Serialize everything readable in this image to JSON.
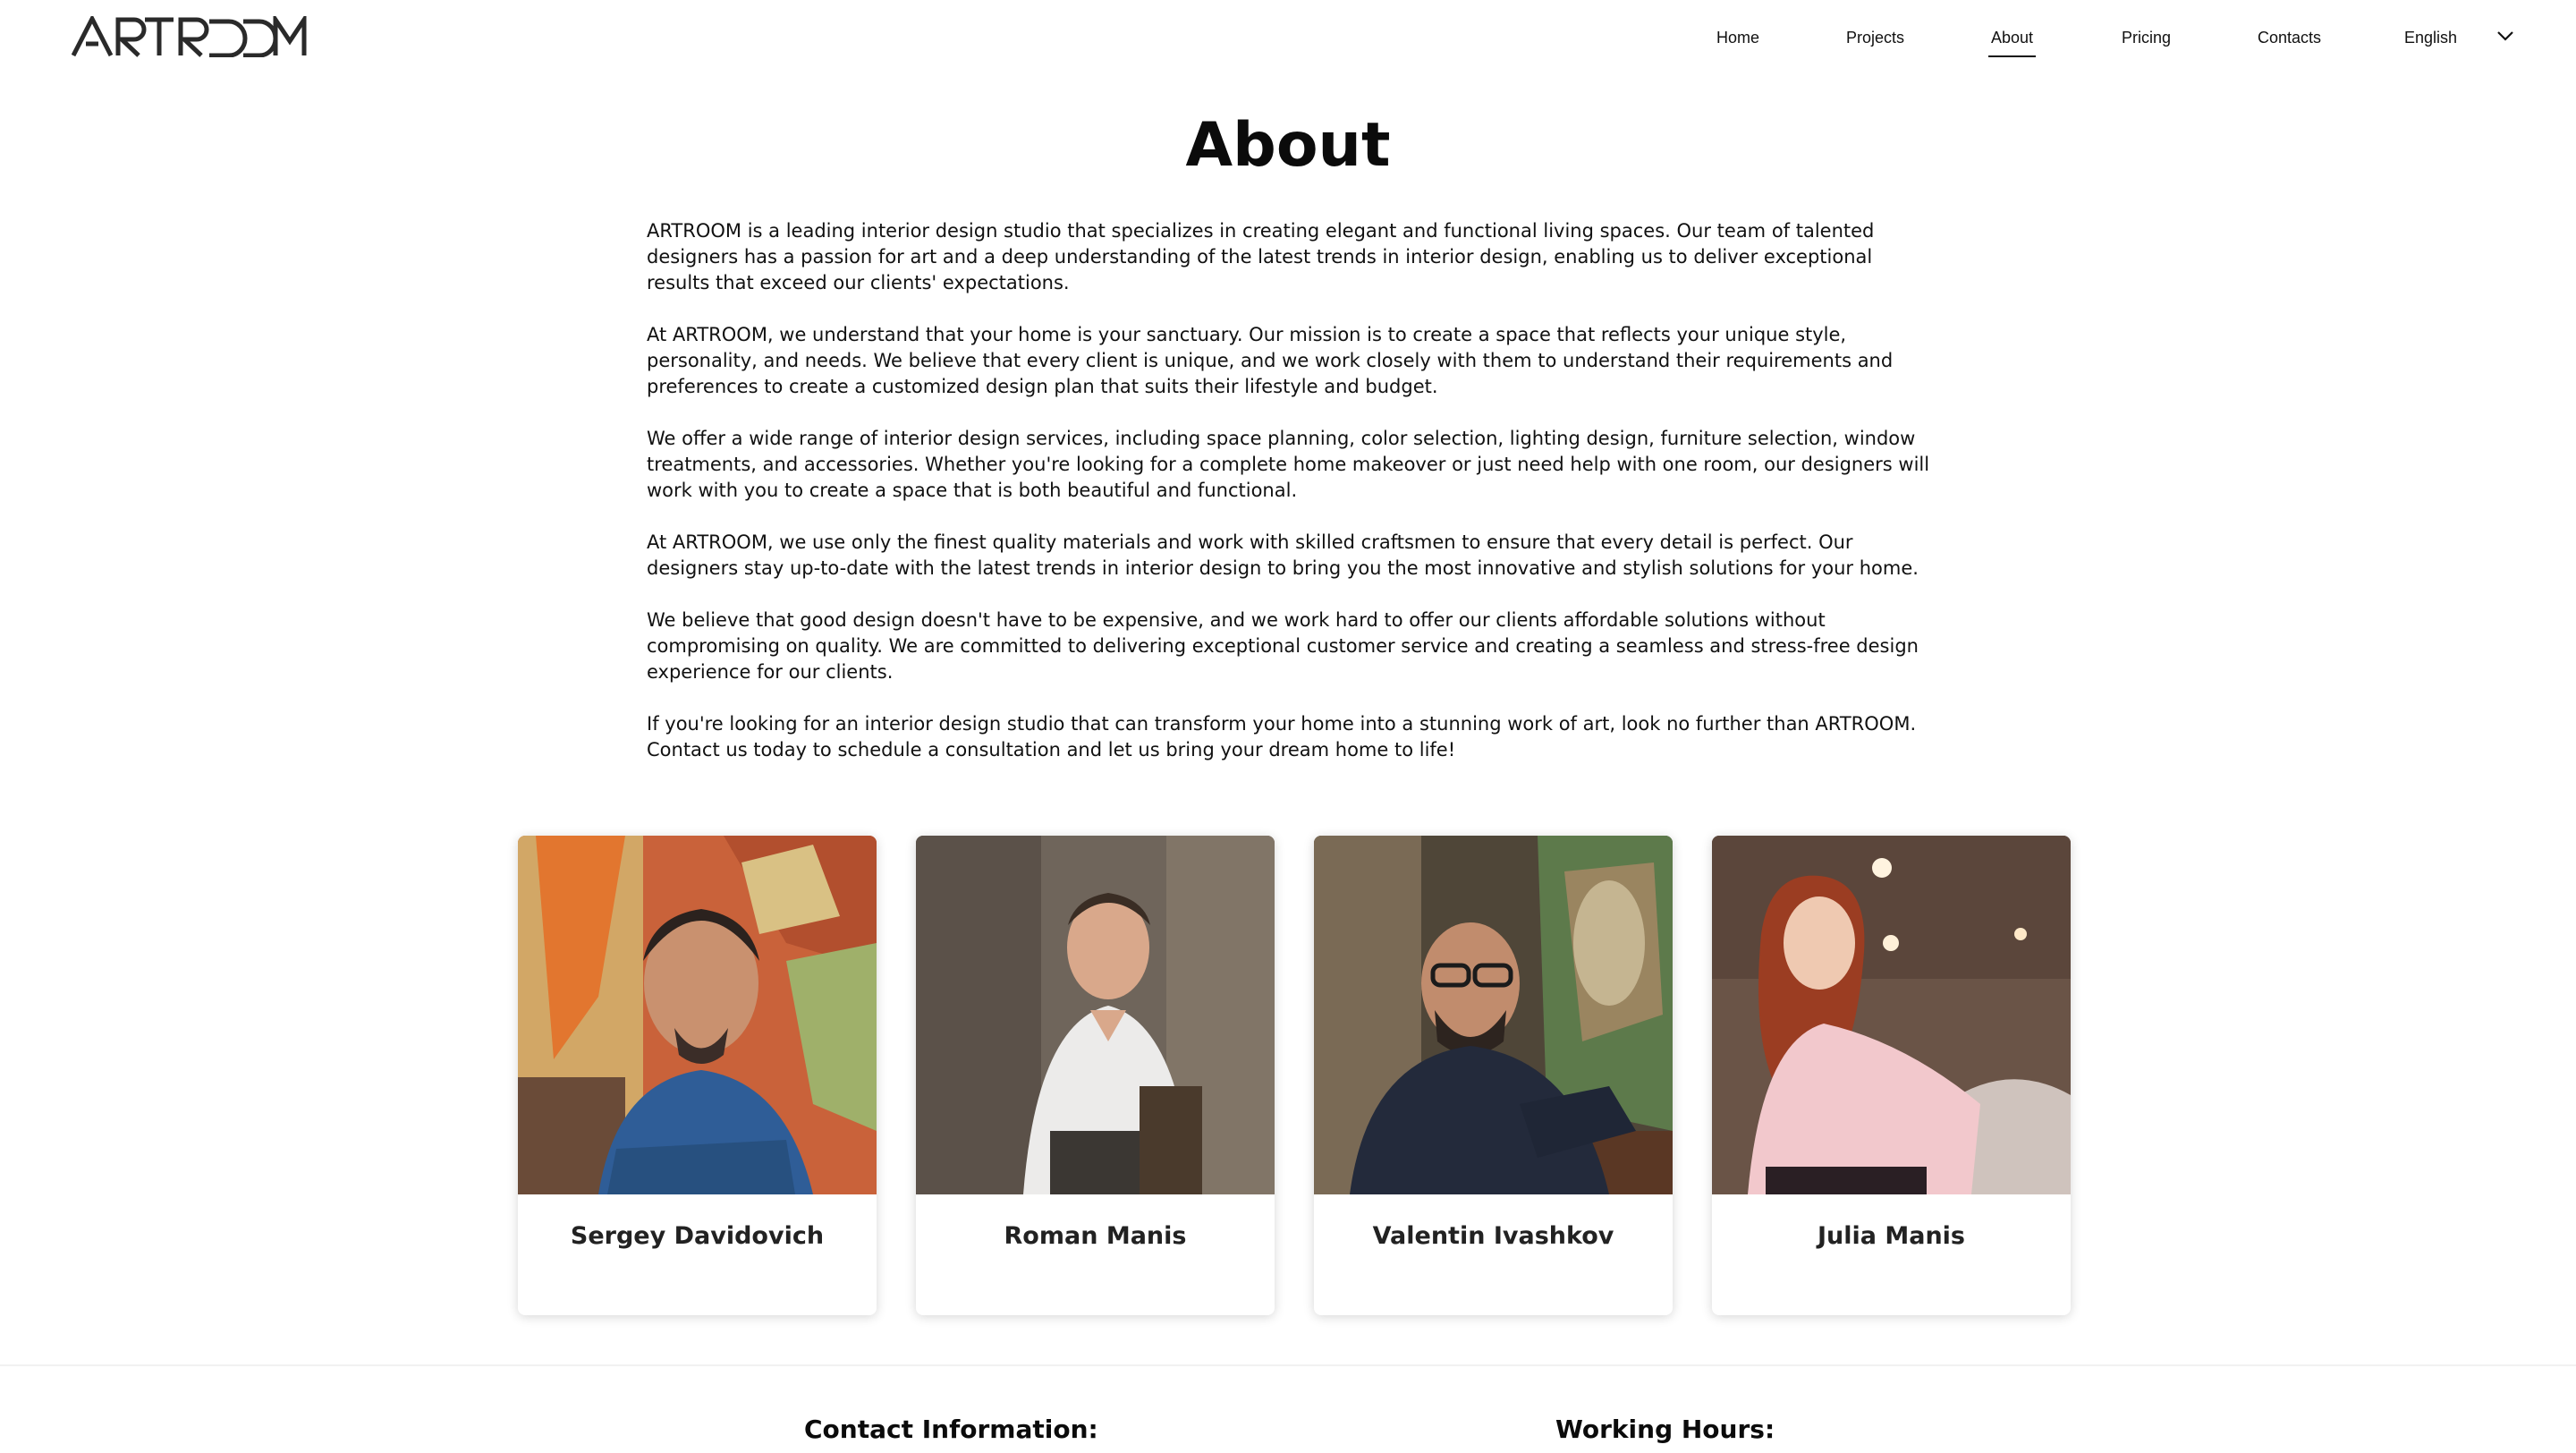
{
  "header": {
    "logo_text": "ARTROOM",
    "nav": [
      {
        "label": "Home"
      },
      {
        "label": "Projects"
      },
      {
        "label": "About"
      },
      {
        "label": "Pricing"
      },
      {
        "label": "Contacts"
      }
    ],
    "active_nav": "About",
    "language": {
      "selected": "English"
    }
  },
  "main": {
    "title": "About",
    "paragraphs": [
      "ARTROOM is a leading interior design studio that specializes in creating elegant and functional living spaces. Our team of talented designers has a passion for art and a deep understanding of the latest trends in interior design, enabling us to deliver exceptional results that exceed our clients' expectations.",
      "At ARTROOM, we understand that your home is your sanctuary. Our mission is to create a space that reflects your unique style, personality, and needs. We believe that every client is unique, and we work closely with them to understand their requirements and preferences to create a customized design plan that suits their lifestyle and budget.",
      "We offer a wide range of interior design services, including space planning, color selection, lighting design, furniture selection, window treatments, and accessories. Whether you're looking for a complete home makeover or just need help with one room, our designers will work with you to create a space that is both beautiful and functional.",
      "At ARTROOM, we use only the finest quality materials and work with skilled craftsmen to ensure that every detail is perfect. Our designers stay up-to-date with the latest trends in interior design to bring you the most innovative and stylish solutions for your home.",
      "We believe that good design doesn't have to be expensive, and we work hard to offer our clients affordable solutions without compromising on quality. We are committed to delivering exceptional customer service and creating a seamless and stress-free design experience for our clients.",
      "If you're looking for an interior design studio that can transform your home into a stunning work of art, look no further than ARTROOM. Contact us today to schedule a consultation and let us bring your dream home to life!"
    ]
  },
  "team": [
    {
      "name": "Sergey Davidovich"
    },
    {
      "name": "Roman Manis"
    },
    {
      "name": "Valentin Ivashkov"
    },
    {
      "name": "Julia Manis"
    }
  ],
  "footer": {
    "contact_heading": "Contact Information:",
    "hours_heading": "Working Hours:"
  },
  "colors": {
    "text": "#111111",
    "background": "#ffffff",
    "card_name": "#222222"
  },
  "icons": [
    "chevron-down-icon"
  ]
}
